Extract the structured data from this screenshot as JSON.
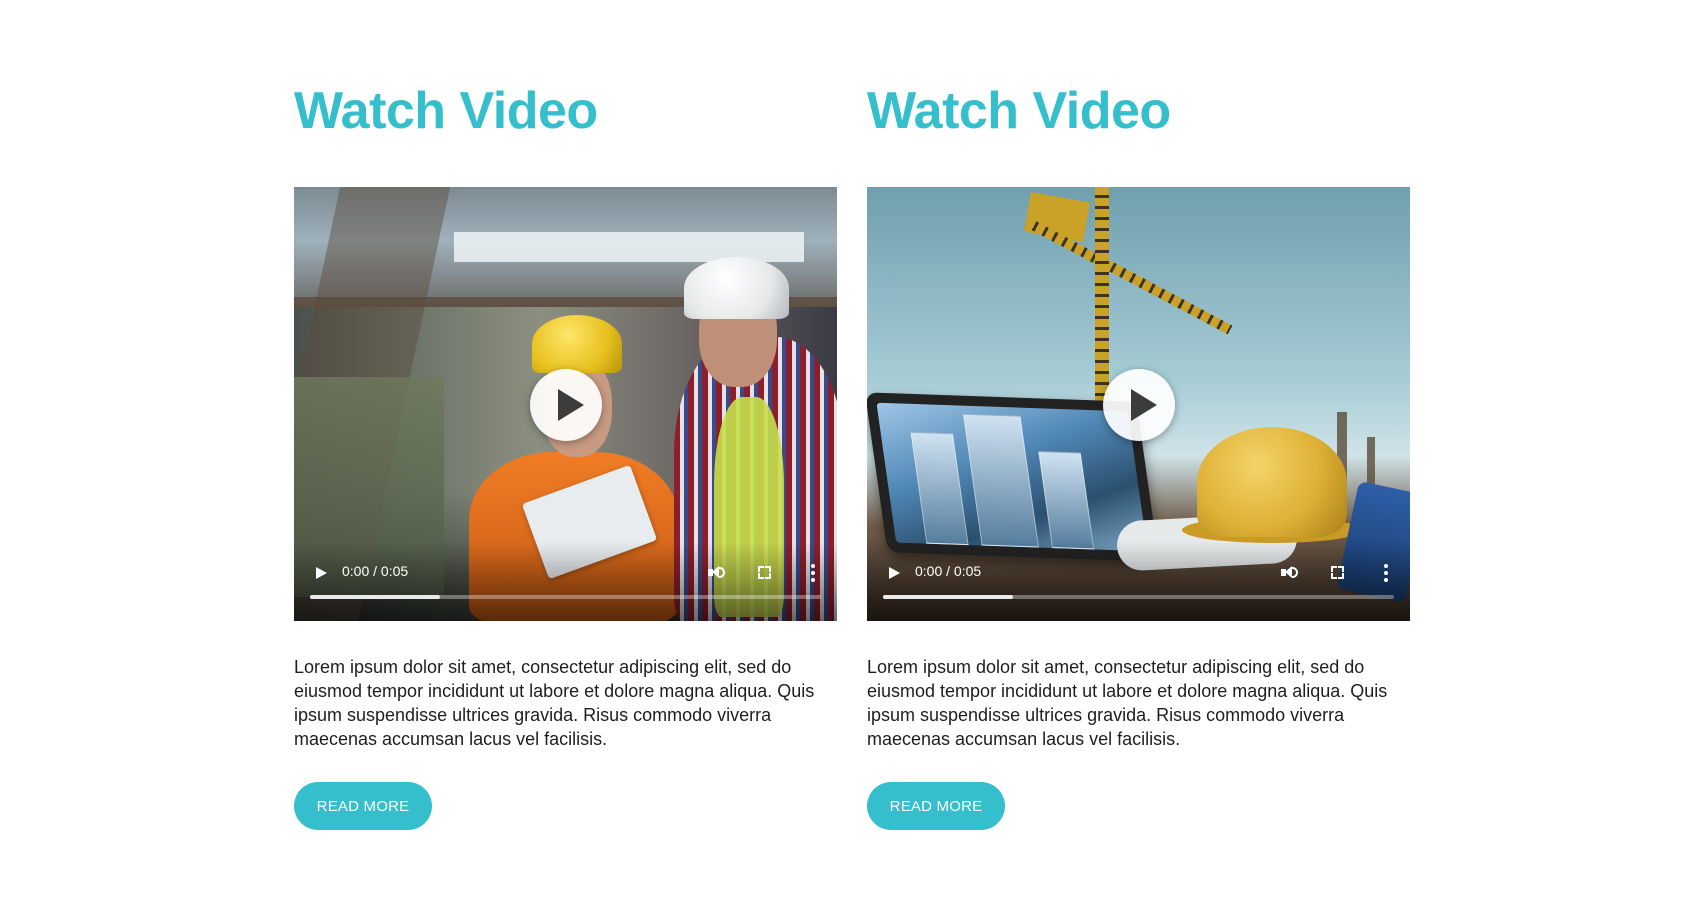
{
  "colors": {
    "accent": "#35bfcc",
    "text": "#1e1e1e",
    "button_text": "#ffffff"
  },
  "cards": [
    {
      "title": "Watch Video",
      "video": {
        "scene": "industrial workers with hard hats",
        "time": "0:00 / 0:05",
        "progress_fraction": 0.255
      },
      "description": "Lorem ipsum dolor sit amet, consectetur adipiscing elit, sed do eiusmod tempor incididunt ut labore et dolore magna aliqua. Quis ipsum suspendisse ultrices gravida. Risus commodo viverra maecenas accumsan lacus vel facilisis.",
      "button_label": "READ MORE"
    },
    {
      "title": "Watch Video",
      "video": {
        "scene": "construction site with crane, tablet and hard hat",
        "time": "0:00 / 0:05",
        "progress_fraction": 0.255
      },
      "description": "Lorem ipsum dolor sit amet, consectetur adipiscing elit, sed do eiusmod tempor incididunt ut labore et dolore magna aliqua. Quis ipsum suspendisse ultrices gravida. Risus commodo viverra maecenas accumsan lacus vel facilisis.",
      "button_label": "READ MORE"
    }
  ],
  "icons": [
    "play-icon",
    "volume-icon",
    "fullscreen-icon",
    "more-options-icon"
  ]
}
